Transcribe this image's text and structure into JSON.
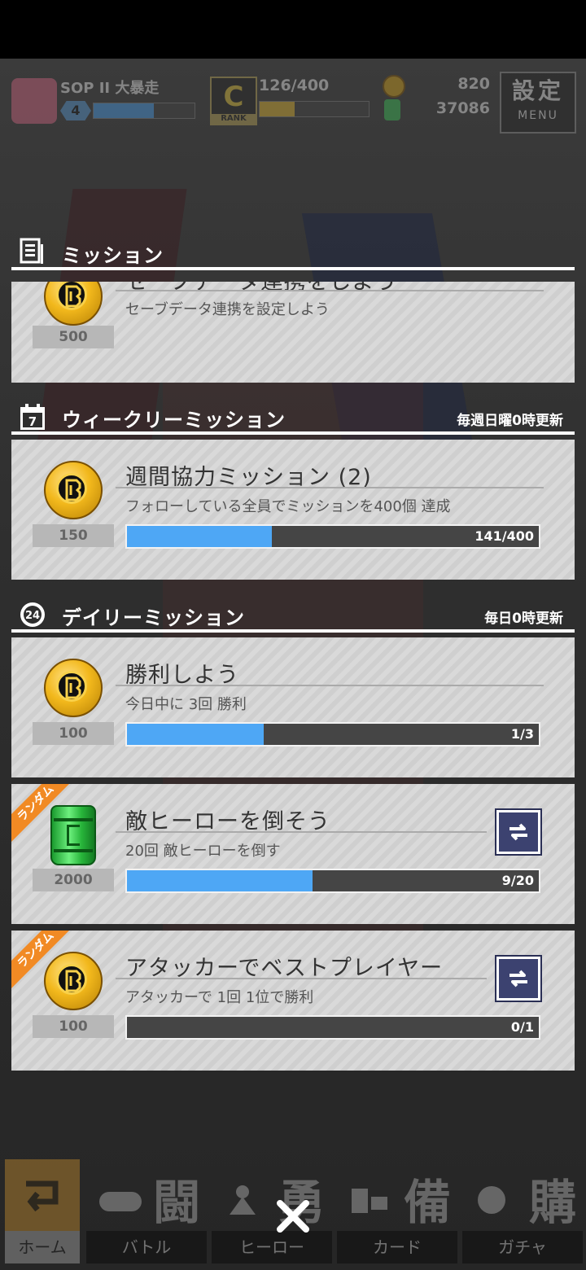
{
  "hud": {
    "player_name": "SOP II 大暴走",
    "level": "4",
    "rank_letter": "C",
    "rank_label": "RANK",
    "rank_progress": "126/400",
    "coins": "820",
    "energy": "37086",
    "menu_kanji": "設定",
    "menu_label": "MENU"
  },
  "mission_header": {
    "title": "ミッション"
  },
  "partial_mission": {
    "title": "セーブデータ連携をしよう",
    "description": "セーブデータ連携を設定しよう",
    "reward": "500"
  },
  "weekly": {
    "title": "ウィークリーミッション",
    "refresh_note": "毎週日曜0時更新",
    "icon_number": "7",
    "missions": [
      {
        "title": "週間協力ミッション (2)",
        "description": "フォローしている全員でミッションを400個 達成",
        "reward": "150",
        "progress_text": "141/400",
        "progress": 0.3525
      }
    ]
  },
  "daily": {
    "title": "デイリーミッション",
    "refresh_note": "毎日0時更新",
    "icon_number": "24",
    "missions": [
      {
        "title": "勝利しよう",
        "description": "今日中に 3回 勝利",
        "reward": "100",
        "progress_text": "1/3",
        "progress": 0.333,
        "reward_icon": "coin-icon"
      },
      {
        "title": "敵ヒーローを倒そう",
        "description": "20回 敵ヒーローを倒す",
        "reward": "2000",
        "progress_text": "9/20",
        "progress": 0.45,
        "reward_icon": "green-can-icon",
        "ribbon": "ランダム"
      },
      {
        "title": "アタッカーでベストプレイヤー",
        "description": "アタッカーで 1回 1位で勝利",
        "reward": "100",
        "progress_text": "0/1",
        "progress": 0,
        "reward_icon": "coin-icon",
        "ribbon": "ランダム"
      }
    ]
  },
  "bottom_nav": {
    "home": "ホーム",
    "items": [
      {
        "label": "バトル",
        "kanji": "闘"
      },
      {
        "label": "ヒーロー",
        "kanji": "勇"
      },
      {
        "label": "カード",
        "kanji": "備"
      },
      {
        "label": "ガチャ",
        "kanji": "購"
      }
    ]
  },
  "colors": {
    "progress_fill": "#4ea7f5",
    "ribbon": "#f18a24",
    "refresh_button": "#3c4270"
  }
}
